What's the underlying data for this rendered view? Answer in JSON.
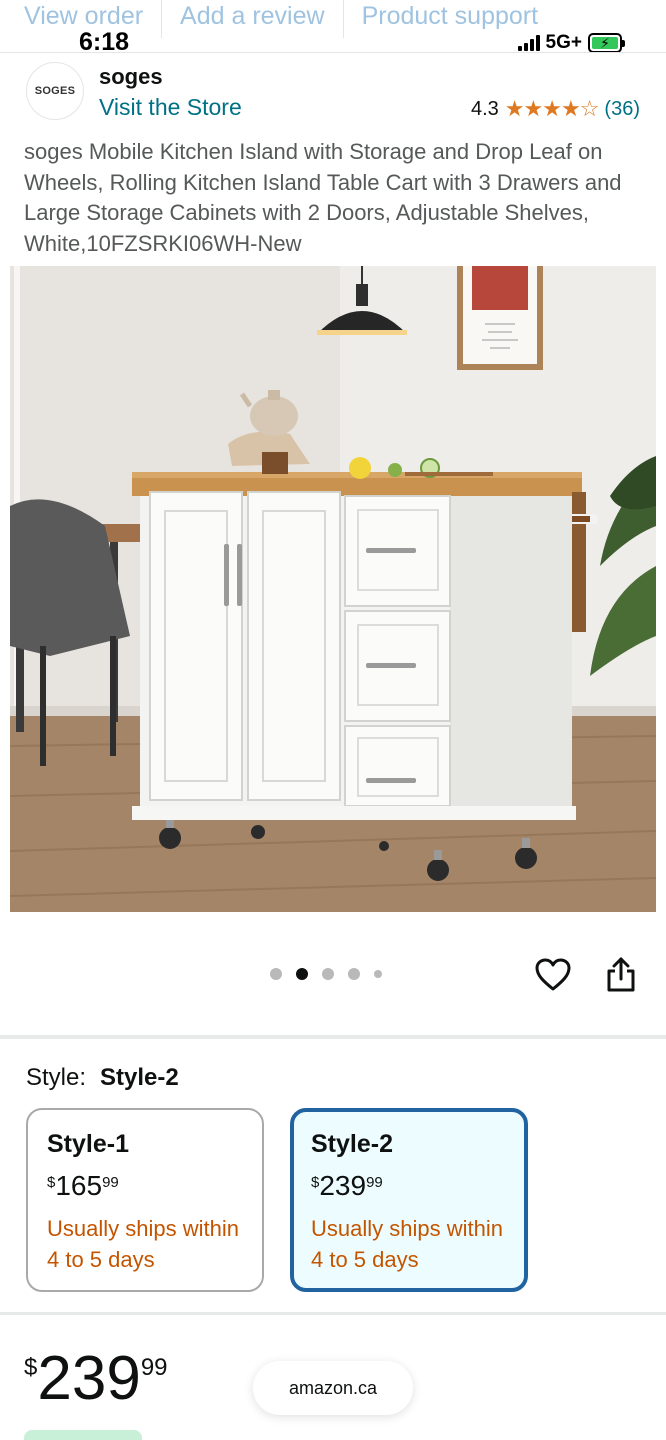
{
  "top_links": [
    "View order",
    "Add a review",
    "Product support"
  ],
  "status_bar": {
    "time": "6:18",
    "network": "5G+",
    "battery_icon": "battery-charging-icon"
  },
  "brand": {
    "logo_text": "SOGES",
    "name": "soges",
    "visit_store": "Visit the Store"
  },
  "rating": {
    "value": "4.3",
    "stars": "★★★★☆",
    "count": "(36)"
  },
  "product": {
    "title": "soges Mobile Kitchen Island with Storage and Drop Leaf on Wheels, Rolling Kitchen Island Table Cart with 3 Drawers and Large Storage Cabinets with 2 Doors, Adjustable Shelves, White,10FZSRKI06WH-New"
  },
  "carousel": {
    "image_count": 5,
    "active_index": 1
  },
  "style": {
    "label": "Style:",
    "selected": "Style-2",
    "options": [
      {
        "name": "Style-1",
        "currency": "$",
        "whole": "165",
        "fraction": "99",
        "shipping": "Usually ships within 4 to 5 days"
      },
      {
        "name": "Style-2",
        "currency": "$",
        "whole": "239",
        "fraction": "99",
        "shipping": "Usually ships within 4 to 5 days"
      }
    ]
  },
  "price": {
    "currency": "$",
    "whole": "239",
    "fraction": "99"
  },
  "domain": "amazon.ca",
  "colors": {
    "link": "#007185",
    "star": "#de7921",
    "shipping": "#c45500",
    "selected_border": "#2162a1",
    "selected_bg": "#edfdff"
  }
}
